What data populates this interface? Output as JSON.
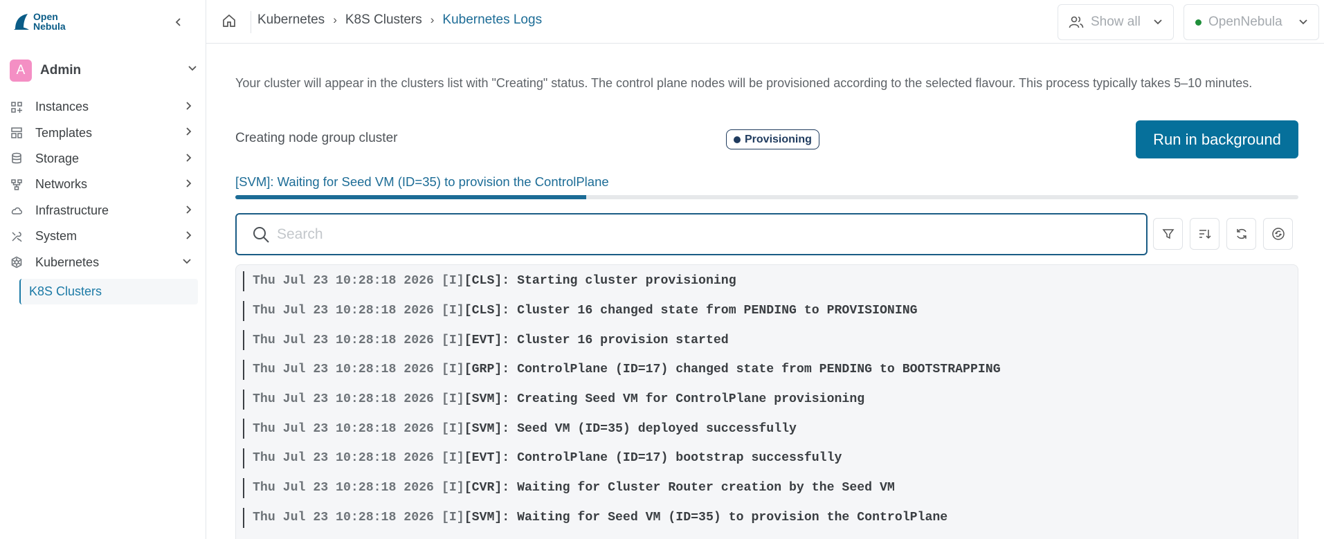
{
  "app": {
    "logo_line1": "Open",
    "logo_line2": "Nebula"
  },
  "user": {
    "initial": "A",
    "name": "Admin"
  },
  "sidebar": {
    "items": [
      {
        "label": "Instances",
        "icon": "instances-icon"
      },
      {
        "label": "Templates",
        "icon": "templates-icon"
      },
      {
        "label": "Storage",
        "icon": "storage-icon"
      },
      {
        "label": "Networks",
        "icon": "networks-icon"
      },
      {
        "label": "Infrastructure",
        "icon": "cloud-icon"
      },
      {
        "label": "System",
        "icon": "tools-icon"
      },
      {
        "label": "Kubernetes",
        "icon": "kubernetes-icon"
      }
    ],
    "subitem": "K8S Clusters"
  },
  "breadcrumb": [
    "Kubernetes",
    "K8S Clusters",
    "Kubernetes Logs"
  ],
  "header": {
    "show_all": "Show all",
    "zone": "OpenNebula",
    "zone_status_color": "#1f8f3a"
  },
  "main": {
    "info": "Your cluster will appear in the clusters list with \"Creating\" status. The control plane nodes will be provisioned according to the selected flavour. This process typically takes 5–10 minutes.",
    "task": "Creating node group cluster",
    "status": "Provisioning",
    "run_button": "Run in background",
    "step": "[SVM]: Waiting for Seed VM (ID=35) to provision the ControlPlane",
    "progress": 0.33,
    "search_placeholder": "Search",
    "accent_color": "#06709b"
  },
  "logs": [
    {
      "ts": "Thu Jul 23 10:28:18 2026",
      "lvl": "[I]",
      "msg": "[CLS]: Starting cluster provisioning"
    },
    {
      "ts": "Thu Jul 23 10:28:18 2026",
      "lvl": "[I]",
      "msg": "[CLS]: Cluster 16 changed state from PENDING to PROVISIONING"
    },
    {
      "ts": "Thu Jul 23 10:28:18 2026",
      "lvl": "[I]",
      "msg": "[EVT]: Cluster 16 provision started"
    },
    {
      "ts": "Thu Jul 23 10:28:18 2026",
      "lvl": "[I]",
      "msg": "[GRP]: ControlPlane (ID=17) changed state from PENDING to BOOTSTRAPPING"
    },
    {
      "ts": "Thu Jul 23 10:28:18 2026",
      "lvl": "[I]",
      "msg": "[SVM]: Creating Seed VM for ControlPlane provisioning"
    },
    {
      "ts": "Thu Jul 23 10:28:18 2026",
      "lvl": "[I]",
      "msg": "[SVM]: Seed VM (ID=35) deployed successfully"
    },
    {
      "ts": "Thu Jul 23 10:28:18 2026",
      "lvl": "[I]",
      "msg": "[EVT]: ControlPlane (ID=17) bootstrap successfully"
    },
    {
      "ts": "Thu Jul 23 10:28:18 2026",
      "lvl": "[I]",
      "msg": "[CVR]: Waiting for Cluster Router creation by the Seed VM"
    },
    {
      "ts": "Thu Jul 23 10:28:18 2026",
      "lvl": "[I]",
      "msg": "[SVM]: Waiting for Seed VM (ID=35) to provision the ControlPlane"
    }
  ]
}
